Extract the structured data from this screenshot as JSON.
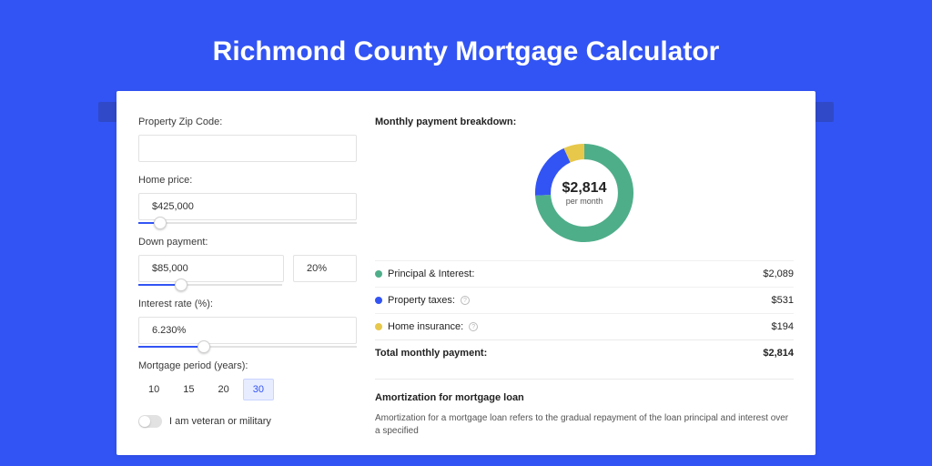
{
  "page_title": "Richmond County Mortgage Calculator",
  "left": {
    "zip_label": "Property Zip Code:",
    "zip_value": "",
    "price_label": "Home price:",
    "price_value": "$425,000",
    "down_label": "Down payment:",
    "down_value": "$85,000",
    "down_pct": "20%",
    "rate_label": "Interest rate (%):",
    "rate_value": "6.230%",
    "period_label": "Mortgage period (years):",
    "periods": {
      "p10": "10",
      "p15": "15",
      "p20": "20",
      "p30": "30"
    },
    "period_selected": "30",
    "veteran_label": "I am veteran or military"
  },
  "breakdown": {
    "head": "Monthly payment breakdown:",
    "center_value": "$2,814",
    "center_sub": "per month",
    "rows": {
      "pi": {
        "label": "Principal & Interest:",
        "value": "$2,089",
        "color": "#4fae8a"
      },
      "tax": {
        "label": "Property taxes:",
        "value": "$531",
        "color": "#3254f4"
      },
      "ins": {
        "label": "Home insurance:",
        "value": "$194",
        "color": "#e7c84b"
      }
    },
    "total_label": "Total monthly payment:",
    "total_value": "$2,814"
  },
  "amort": {
    "head": "Amortization for mortgage loan",
    "body": "Amortization for a mortgage loan refers to the gradual repayment of the loan principal and interest over a specified"
  },
  "chart_data": {
    "type": "pie",
    "title": "Monthly payment breakdown",
    "series": [
      {
        "name": "Principal & Interest",
        "value": 2089,
        "color": "#4fae8a"
      },
      {
        "name": "Property taxes",
        "value": 531,
        "color": "#3254f4"
      },
      {
        "name": "Home insurance",
        "value": 194,
        "color": "#e7c84b"
      }
    ],
    "total": 2814,
    "center_label": "$2,814 per month"
  }
}
